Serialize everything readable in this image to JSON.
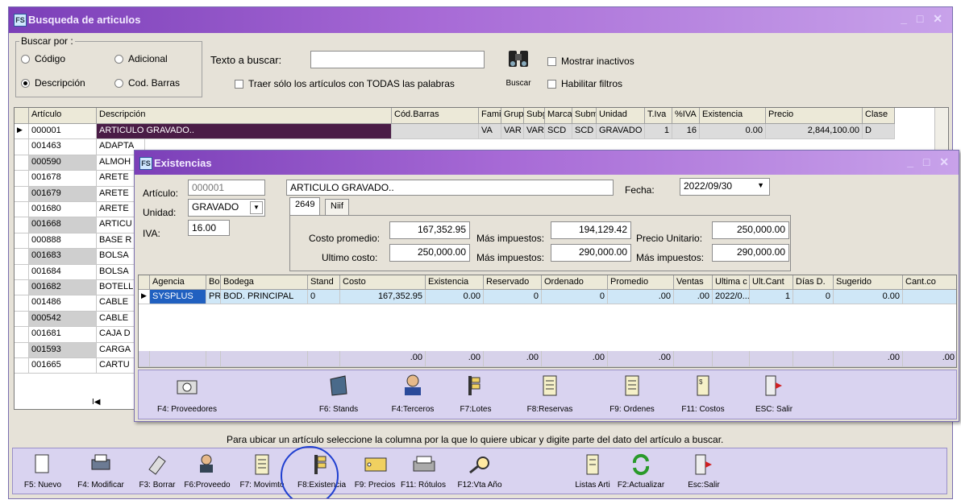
{
  "main": {
    "title": "Busqueda de articulos",
    "search_group_label": "Buscar por :",
    "radios": [
      {
        "label": "Código",
        "checked": false
      },
      {
        "label": "Adicional",
        "checked": false
      },
      {
        "label": "Descripción",
        "checked": true
      },
      {
        "label": "Cod. Barras",
        "checked": false
      }
    ],
    "search_label": "Texto a buscar:",
    "search_value": "",
    "all_words_label": "Traer sólo los artículos con TODAS las palabras",
    "buscar_label": "Buscar",
    "inactive_label": "Mostrar inactivos",
    "filters_label": "Habilitar filtros",
    "columns": [
      "Artículo",
      "Descripción",
      "Cód.Barras",
      "Fami",
      "Grupo",
      "Subg",
      "Marca",
      "Subm",
      "Unidad",
      "T.Iva",
      "%IVA",
      "Existencia",
      "Precio",
      "Clase"
    ],
    "selected_row": [
      "000001",
      "ARTICULO GRAVADO..",
      "",
      "VA",
      "VAR",
      "VAR",
      "SCD",
      "SCD",
      "GRAVADO",
      "1",
      "16",
      "0.00",
      "2,844,100.00",
      "D"
    ],
    "rows": [
      {
        "code": "001463",
        "desc": "ADAPTA"
      },
      {
        "code": "000590",
        "desc": "ALMOH"
      },
      {
        "code": "001678",
        "desc": "ARETE"
      },
      {
        "code": "001679",
        "desc": "ARETE"
      },
      {
        "code": "001680",
        "desc": "ARETE"
      },
      {
        "code": "001668",
        "desc": "ARTICU"
      },
      {
        "code": "000888",
        "desc": "BASE R"
      },
      {
        "code": "001683",
        "desc": "BOLSA"
      },
      {
        "code": "001684",
        "desc": "BOLSA"
      },
      {
        "code": "001682",
        "desc": "BOTELL"
      },
      {
        "code": "001486",
        "desc": "CABLE"
      },
      {
        "code": "000542",
        "desc": "CABLE"
      },
      {
        "code": "001681",
        "desc": "CAJA D"
      },
      {
        "code": "001593",
        "desc": "CARGA"
      },
      {
        "code": "001665",
        "desc": "CARTU"
      }
    ],
    "nav_first": "I◀",
    "status_text": "Para ubicar un artículo seleccione la columna por la que lo quiere ubicar y digite parte del dato del artículo a buscar.",
    "toolbar": [
      {
        "label": "F5: Nuevo",
        "icon": "new-doc-icon"
      },
      {
        "label": "F4: Modificar",
        "icon": "printer-icon"
      },
      {
        "label": "F3: Borrar",
        "icon": "eraser-icon"
      },
      {
        "label": "F6:Proveedo",
        "icon": "person-search-icon"
      },
      {
        "label": "F7: Movimto",
        "icon": "document-list-icon"
      },
      {
        "label": "F8:Existencia",
        "icon": "signpost-hand-icon"
      },
      {
        "label": "F9: Precios",
        "icon": "price-tag-icon"
      },
      {
        "label": "F11: Rótulos",
        "icon": "label-printer-icon"
      },
      {
        "label": "F12:Vta Año",
        "icon": "magnifier-chart-icon"
      },
      {
        "label": "Listas Arti",
        "icon": "list-icon"
      },
      {
        "label": "F2:Actualizar",
        "icon": "refresh-icon"
      },
      {
        "label": "Esc:Salir",
        "icon": "exit-icon"
      }
    ]
  },
  "sub": {
    "title": "Existencias",
    "articulo_label": "Artículo:",
    "articulo_code": "000001",
    "articulo_desc": "ARTICULO GRAVADO..",
    "fecha_label": "Fecha:",
    "fecha_value": "2022/09/30",
    "unidad_label": "Unidad:",
    "unidad_value": "GRAVADO",
    "iva_label": "IVA:",
    "iva_value": "16.00",
    "tabs": [
      "2649",
      "Niif"
    ],
    "costo_promedio_label": "Costo promedio:",
    "costo_promedio": "167,352.95",
    "mas_impuestos_label": "Más impuestos:",
    "mas_impuestos_1": "194,129.42",
    "precio_unitario_label": "Precio Unitario:",
    "precio_unitario": "250,000.00",
    "ultimo_costo_label": "Ultimo costo:",
    "ultimo_costo": "250,000.00",
    "mas_impuestos_2": "290,000.00",
    "mas_impuestos_3": "290,000.00",
    "columns": [
      "Agencia",
      "Bode",
      "Bodega",
      "Stand",
      "Costo",
      "Existencia",
      "Reservado",
      "Ordenado",
      "Promedio",
      "Ventas",
      "Ultima c",
      "Ult.Cant",
      "Días D.",
      "Sugerido",
      "Cant.co"
    ],
    "row": [
      "SYSPLUS",
      "PR",
      "BOD. PRINCIPAL",
      "0",
      "167,352.95",
      "0.00",
      "0",
      "0",
      ".00",
      ".00",
      "2022/0...",
      "1",
      "0",
      "0.00",
      ""
    ],
    "totals": [
      "",
      "",
      "",
      "",
      "",
      ".00",
      ".00",
      ".00",
      ".00",
      ".00",
      "",
      "",
      "",
      "",
      ".00",
      ".00"
    ],
    "toolbar": [
      {
        "label": "F4: Proveedores",
        "icon": "camera-icon"
      },
      {
        "label": "F6: Stands",
        "icon": "shelf-icon"
      },
      {
        "label": "F4:Terceros",
        "icon": "person-icon"
      },
      {
        "label": "F7:Lotes",
        "icon": "signpost-hand-icon"
      },
      {
        "label": "F8:Reservas",
        "icon": "document-list-icon"
      },
      {
        "label": "F9: Ordenes",
        "icon": "document-list-icon"
      },
      {
        "label": "F11: Costos",
        "icon": "cost-list-icon"
      },
      {
        "label": "ESC: Salir",
        "icon": "exit-icon"
      }
    ]
  }
}
